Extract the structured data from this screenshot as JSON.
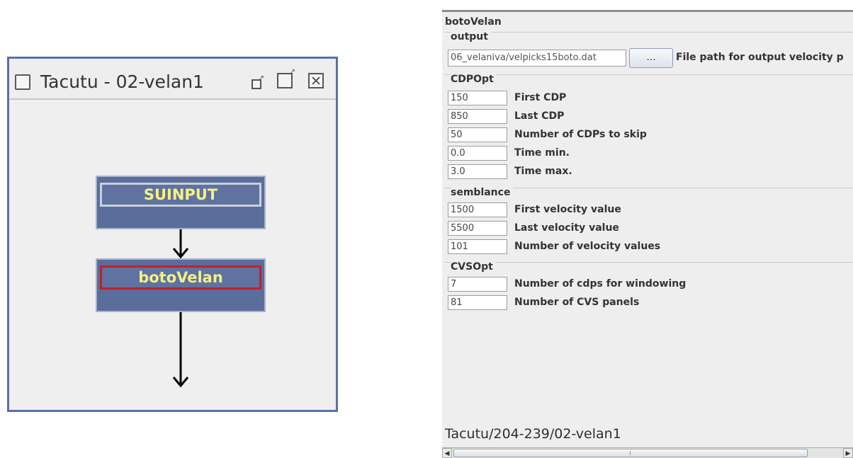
{
  "flow_window": {
    "title": "Tacutu - 02-velan1",
    "nodes": [
      {
        "label": "SUINPUT",
        "selected": false
      },
      {
        "label": "botoVelan",
        "selected": true
      }
    ]
  },
  "param_panel": {
    "title": "botoVelan",
    "groups": {
      "output": {
        "title": "output",
        "path_value": "06_velaniva/velpicks15boto.dat",
        "browse_label": "...",
        "path_label": "File path for output velocity p"
      },
      "cdpopt": {
        "title": "CDPOpt",
        "rows": [
          {
            "value": "150",
            "label": "First CDP"
          },
          {
            "value": "850",
            "label": "Last CDP"
          },
          {
            "value": "50",
            "label": "Number of CDPs to skip"
          },
          {
            "value": "0.0",
            "label": "Time min."
          },
          {
            "value": "3.0",
            "label": "Time max."
          }
        ]
      },
      "semblance": {
        "title": "semblance",
        "rows": [
          {
            "value": "1500",
            "label": "First velocity value"
          },
          {
            "value": "5500",
            "label": "Last velocity value"
          },
          {
            "value": "101",
            "label": "Number of velocity values"
          }
        ]
      },
      "cvsopt": {
        "title": "CVSOpt",
        "rows": [
          {
            "value": "7",
            "label": "Number of cdps for windowing"
          },
          {
            "value": "81",
            "label": "Number of CVS panels"
          }
        ]
      }
    },
    "status_path": "Tacutu/204-239/02-velan1"
  },
  "colors": {
    "node_fill": "#5a6d9b",
    "node_text": "#f4f183",
    "selected_border": "#c0202a",
    "window_border": "#5b6fa8"
  }
}
